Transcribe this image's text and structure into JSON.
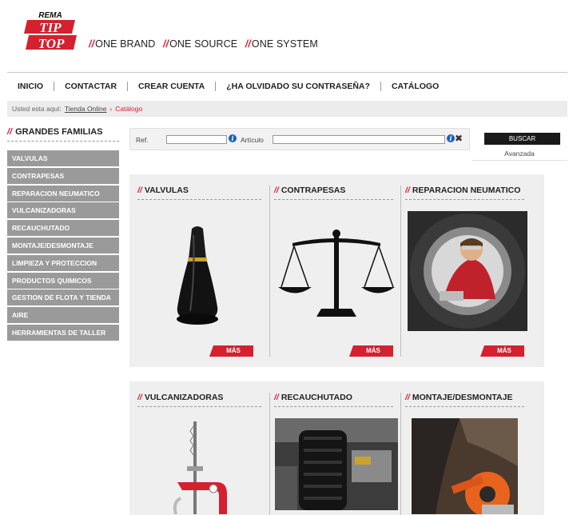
{
  "brand": {
    "logo_top": "REMA",
    "logo_mid": "TIP",
    "logo_bot": "TOP",
    "slash": "//",
    "tagline": [
      "ONE BRAND",
      "ONE SOURCE",
      "ONE SYSTEM"
    ]
  },
  "nav": [
    "INICIO",
    "CONTACTAR",
    "CREAR CUENTA",
    "¿HA OLVIDADO SU CONTRASEÑA?",
    "CATÁLOGO"
  ],
  "breadcrumb": {
    "prefix": "Usted esta aquí:",
    "link": "Tienda Online",
    "separator": "›",
    "current": "Catálogo"
  },
  "sidebar": {
    "title": "GRANDES FAMILIAS",
    "items": [
      "VALVULAS",
      "CONTRAPESAS",
      "REPARACION NEUMATICO",
      "VULCANIZADORAS",
      "RECAUCHUTADO",
      "MONTAJE/DESMONTAJE",
      "LIMPIEZA Y PROTECCION",
      "PRODUCTOS QUIMICOS",
      "GESTION DE FLOTA Y TIENDA",
      "AIRE",
      "HERRAMIENTAS DE TALLER"
    ]
  },
  "search": {
    "ref_label": "Ref.",
    "ref_value": "",
    "articulo_label": "Artículo",
    "articulo_value": "",
    "info_glyph": "i",
    "clear_glyph": "✖",
    "button": "BUSCAR",
    "advanced": "Avanzada"
  },
  "products": {
    "mas": "MÁS",
    "row1": [
      "VALVULAS",
      "CONTRAPESAS",
      "REPARACION NEUMATICO"
    ],
    "row2": [
      "VULCANIZADORAS",
      "RECAUCHUTADO",
      "MONTAJE/DESMONTAJE"
    ]
  },
  "colors": {
    "accent": "#d4202f",
    "sidebar": "#9a9a9a",
    "panel": "#efefef"
  }
}
